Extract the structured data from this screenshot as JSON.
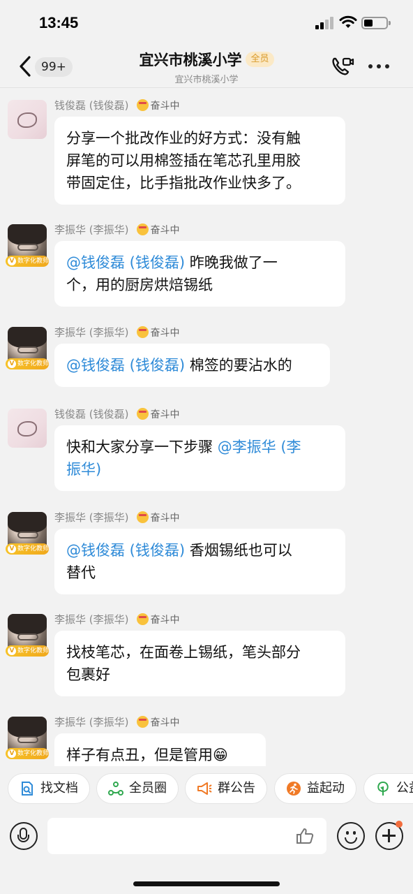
{
  "status_bar": {
    "time": "13:45"
  },
  "header": {
    "unread_count": "99+",
    "group_name": "宜兴市桃溪小学",
    "member_tag": "全员",
    "subtitle": "宜兴市桃溪小学"
  },
  "messages": [
    {
      "sender": "钱俊磊 (钱俊磊)",
      "status": "奋斗中",
      "avatar": "sketch",
      "badge": "",
      "lines": [
        "分享一个批改作业的好方式：没有触",
        "屏笔的可以用棉签插在笔芯孔里用胶",
        "带固定住，比手指批改作业快多了。"
      ]
    },
    {
      "sender": "李振华 (李振华)",
      "status": "奋斗中",
      "avatar": "photo",
      "badge": "数字化教师",
      "mention": "@钱俊磊 (钱俊磊)",
      "text_a": " 昨晚我做了一",
      "text_b": "个，用的厨房烘焙锡纸"
    },
    {
      "sender": "李振华 (李振华)",
      "status": "奋斗中",
      "avatar": "photo",
      "badge": "数字化教师",
      "mention": "@钱俊磊 (钱俊磊)",
      "text_a": " 棉签的要沾水的"
    },
    {
      "sender": "钱俊磊 (钱俊磊)",
      "status": "奋斗中",
      "avatar": "sketch",
      "badge": "",
      "text_a": "快和大家分享一下步骤 ",
      "mention_a": "@李振华 (李",
      "mention_b": "振华)"
    },
    {
      "sender": "李振华 (李振华)",
      "status": "奋斗中",
      "avatar": "photo",
      "badge": "数字化教师",
      "mention": "@钱俊磊 (钱俊磊)",
      "text_a": " 香烟锡纸也可以",
      "text_b": "替代"
    },
    {
      "sender": "李振华 (李振华)",
      "status": "奋斗中",
      "avatar": "photo",
      "badge": "数字化教师",
      "lines": [
        "找枝笔芯，在面卷上锡纸，笔头部分",
        "包裹好"
      ]
    },
    {
      "sender": "李振华 (李振华)",
      "status": "奋斗中",
      "avatar": "photo",
      "badge": "数字化教师",
      "lines": [
        "样子有点丑，但是管用😁"
      ]
    }
  ],
  "quick_actions": [
    {
      "label": "找文档",
      "icon": "doc-search-icon",
      "color": "#2f8bd8"
    },
    {
      "label": "全员圈",
      "icon": "circle-nodes-icon",
      "color": "#2fa84f"
    },
    {
      "label": "群公告",
      "icon": "megaphone-icon",
      "color": "#f07a26"
    },
    {
      "label": "益起动",
      "icon": "runner-icon",
      "color": "#f07a26"
    },
    {
      "label": "公益",
      "icon": "tree-icon",
      "color": "#2fa84f"
    }
  ],
  "input": {
    "placeholder": ""
  }
}
